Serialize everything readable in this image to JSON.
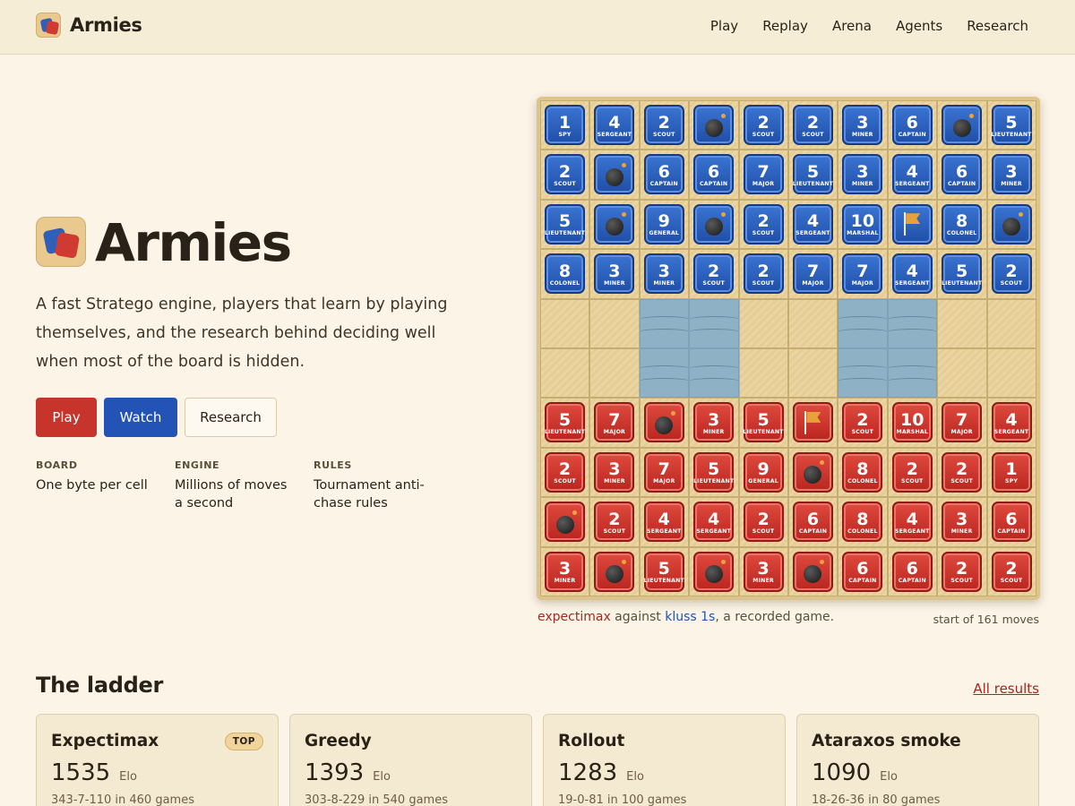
{
  "header": {
    "brand": "Armies",
    "nav": [
      "Play",
      "Replay",
      "Arena",
      "Agents",
      "Research"
    ]
  },
  "hero": {
    "title": "Armies",
    "tagline": "A fast Stratego engine, players that learn by playing themselves, and the research behind deciding well when most of the board is hidden.",
    "buttons": {
      "play": "Play",
      "watch": "Watch",
      "research": "Research"
    },
    "facts": [
      {
        "label": "BOARD",
        "value": "One byte per cell"
      },
      {
        "label": "ENGINE",
        "value": "Millions of moves a second"
      },
      {
        "label": "RULES",
        "value": "Tournament anti-chase rules"
      }
    ]
  },
  "board": {
    "rows": [
      [
        "B1",
        "B4",
        "B2",
        "BB",
        "B2",
        "B2",
        "B3",
        "B6",
        "BB",
        "B5"
      ],
      [
        "B2",
        "BB",
        "B6",
        "B6",
        "B7",
        "B5",
        "B3",
        "B4",
        "B6",
        "B3"
      ],
      [
        "B5",
        "BB",
        "B9",
        "BB",
        "B2",
        "B4",
        "B10",
        "BF",
        "B8",
        "BB"
      ],
      [
        "B8",
        "B3",
        "B3",
        "B2",
        "B2",
        "B7",
        "B7",
        "B4",
        "B5",
        "B2"
      ],
      [
        "",
        "",
        "W",
        "W",
        "",
        "",
        "W",
        "W",
        "",
        ""
      ],
      [
        "",
        "",
        "W",
        "W",
        "",
        "",
        "W",
        "W",
        "",
        ""
      ],
      [
        "R5",
        "R7",
        "RB",
        "R3",
        "R5",
        "RF",
        "R2",
        "R10",
        "R7",
        "R4"
      ],
      [
        "R2",
        "R3",
        "R7",
        "R5",
        "R9",
        "RB",
        "R8",
        "R2",
        "R2",
        "R1"
      ],
      [
        "RB",
        "R2",
        "R4",
        "R4",
        "R2",
        "R6",
        "R8",
        "R4",
        "R3",
        "R6"
      ],
      [
        "R3",
        "RB",
        "R5",
        "RB",
        "R3",
        "RB",
        "R6",
        "R6",
        "R2",
        "R2"
      ]
    ],
    "rank_names": {
      "1": "SPY",
      "2": "SCOUT",
      "3": "MINER",
      "4": "SERGEANT",
      "5": "LIEUTENANT",
      "6": "CAPTAIN",
      "7": "MAJOR",
      "8": "COLONEL",
      "9": "GENERAL",
      "10": "MARSHAL"
    },
    "colors": {
      "blue": "#2f5fb8",
      "red": "#cf3b32",
      "water": "#8fb1c6"
    }
  },
  "game": {
    "player1": "expectimax",
    "against": " against ",
    "player2": "kluss 1s",
    "suffix": ", a recorded game.",
    "moves": "start of 161 moves"
  },
  "ladder": {
    "title": "The ladder",
    "all_results": "All results",
    "unit": "Elo",
    "cards": [
      {
        "name": "Expectimax",
        "badge": "TOP",
        "elo": "1535",
        "record": "343-7-110 in 460 games"
      },
      {
        "name": "Greedy",
        "badge": "",
        "elo": "1393",
        "record": "303-8-229 in 540 games"
      },
      {
        "name": "Rollout",
        "badge": "",
        "elo": "1283",
        "record": "19-0-81 in 100 games"
      },
      {
        "name": "Ataraxos smoke",
        "badge": "",
        "elo": "1090",
        "record": "18-26-36 in 80 games"
      }
    ]
  }
}
